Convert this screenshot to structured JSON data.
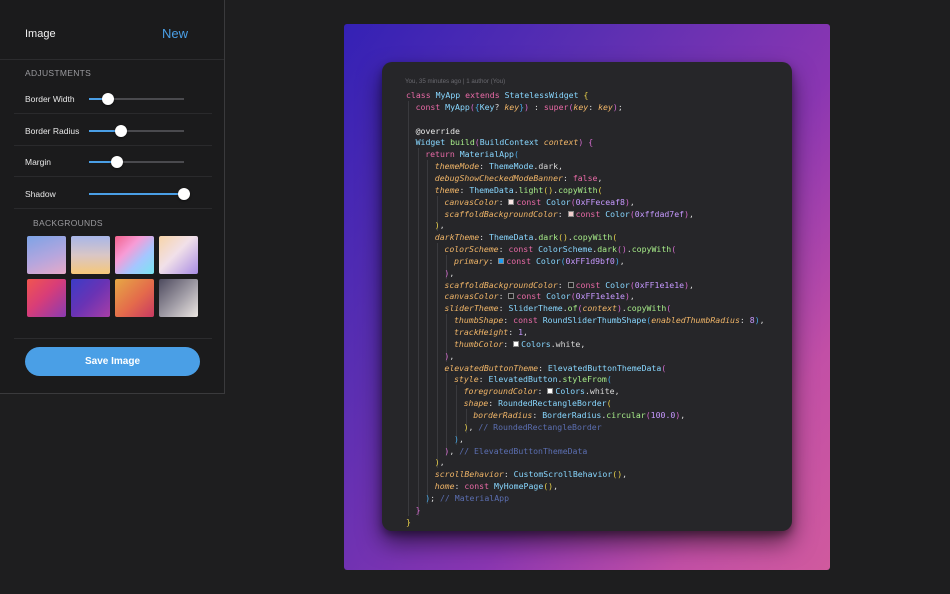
{
  "sidebar": {
    "title": "Image",
    "new_label": "New",
    "adjustments_label": "ADJUSTMENTS",
    "adjustments": [
      {
        "label": "Border Width",
        "value": 0.2
      },
      {
        "label": "Border Radius",
        "value": 0.34
      },
      {
        "label": "Margin",
        "value": 0.29
      },
      {
        "label": "Shadow",
        "value": 1.0
      }
    ],
    "backgrounds_label": "BACKGROUNDS",
    "backgrounds": [
      "linear-gradient(160deg, #7da3e6 0%, #b4a6de 55%, #e6a9c8 100%)",
      "linear-gradient(180deg, #a8b6e8 0%, #d9c6c6 50%, #f6c879 100%)",
      "linear-gradient(135deg, #f2628c 0%, #f79cd6 35%, #a5c6ff 65%, #78e6f0 100%)",
      "linear-gradient(135deg, #f7d4a8 0%, #f1e0e9 45%, #a98de4 100%)",
      "linear-gradient(135deg, #f1554f 0%, #d83d78 45%, #8a3bb2 100%)",
      "linear-gradient(135deg, #3b3cc7 0%, #6a33b4 50%, #a83ea6 100%)",
      "linear-gradient(135deg, #e6a845 0%, #e46b4b 55%, #c83962 100%)",
      "linear-gradient(135deg, #4d4a5e 0%, #a39fa8 55%, #ece6e2 100%)"
    ],
    "save_label": "Save Image",
    "accent": "#4a9fe6"
  },
  "canvas": {
    "gradient_colors": [
      "#3421b5",
      "#5b2fb2",
      "#8a36b2",
      "#c24fa6",
      "#d05a9e"
    ],
    "blame": "You, 35 minutes ago | 1 author (You)",
    "code_lines": [
      {
        "indent": 0,
        "tokens": [
          [
            "kw",
            "class "
          ],
          [
            "cls",
            "MyApp "
          ],
          [
            "kw",
            "extends "
          ],
          [
            "cls",
            "StatelessWidget "
          ],
          [
            "b1",
            "{"
          ]
        ]
      },
      {
        "indent": 1,
        "tokens": [
          [
            "kw",
            "const "
          ],
          [
            "cls",
            "MyApp"
          ],
          [
            "b2",
            "("
          ],
          [
            "b3",
            "{"
          ],
          [
            "cls",
            "Key"
          ],
          [
            "p",
            "? "
          ],
          [
            "param",
            "key"
          ],
          [
            "b3",
            "}"
          ],
          [
            "b2",
            ")"
          ],
          [
            "p",
            " : "
          ],
          [
            "kw",
            "super"
          ],
          [
            "b2",
            "("
          ],
          [
            "param",
            "key"
          ],
          [
            "p",
            ": "
          ],
          [
            "param",
            "key"
          ],
          [
            "b2",
            ")"
          ],
          [
            "p",
            ";"
          ]
        ]
      },
      {
        "indent": 0,
        "tokens": []
      },
      {
        "indent": 1,
        "tokens": [
          [
            "ann",
            "@override"
          ]
        ]
      },
      {
        "indent": 1,
        "tokens": [
          [
            "cls",
            "Widget "
          ],
          [
            "fn",
            "build"
          ],
          [
            "b2",
            "("
          ],
          [
            "cls",
            "BuildContext "
          ],
          [
            "param",
            "context"
          ],
          [
            "b2",
            ")"
          ],
          [
            "p",
            " "
          ],
          [
            "b2",
            "{"
          ]
        ]
      },
      {
        "indent": 2,
        "tokens": [
          [
            "kw",
            "return "
          ],
          [
            "cls",
            "MaterialApp"
          ],
          [
            "b3",
            "("
          ]
        ]
      },
      {
        "indent": 3,
        "tokens": [
          [
            "prop",
            "themeMode"
          ],
          [
            "p",
            ": "
          ],
          [
            "cls",
            "ThemeMode"
          ],
          [
            "p",
            "."
          ],
          [
            "p",
            "dark,"
          ]
        ]
      },
      {
        "indent": 3,
        "tokens": [
          [
            "prop",
            "debugShowCheckedModeBanner"
          ],
          [
            "p",
            ": "
          ],
          [
            "kw",
            "false"
          ],
          [
            "p",
            ","
          ]
        ]
      },
      {
        "indent": 3,
        "tokens": [
          [
            "prop",
            "theme"
          ],
          [
            "p",
            ": "
          ],
          [
            "cls",
            "ThemeData"
          ],
          [
            "p",
            "."
          ],
          [
            "fn",
            "light"
          ],
          [
            "b1",
            "()"
          ],
          [
            "p",
            "."
          ],
          [
            "fn",
            "copyWith"
          ],
          [
            "b1",
            "("
          ]
        ]
      },
      {
        "indent": 4,
        "tokens": [
          [
            "prop",
            "canvasColor"
          ],
          [
            "p",
            ": "
          ],
          [
            "sq",
            "#FFeceaf8"
          ],
          [
            "kw",
            "const "
          ],
          [
            "cls",
            "Color"
          ],
          [
            "b2",
            "("
          ],
          [
            "num",
            "0xFFeceaf8"
          ],
          [
            "b2",
            ")"
          ],
          [
            "p",
            ","
          ]
        ]
      },
      {
        "indent": 4,
        "tokens": [
          [
            "prop",
            "scaffoldBackgroundColor"
          ],
          [
            "p",
            ": "
          ],
          [
            "sq",
            "#ffdad7ef"
          ],
          [
            "kw",
            "const "
          ],
          [
            "cls",
            "Color"
          ],
          [
            "b2",
            "("
          ],
          [
            "num",
            "0xffdad7ef"
          ],
          [
            "b2",
            ")"
          ],
          [
            "p",
            ","
          ]
        ]
      },
      {
        "indent": 3,
        "tokens": [
          [
            "b1",
            ")"
          ],
          [
            "p",
            ","
          ]
        ]
      },
      {
        "indent": 3,
        "tokens": [
          [
            "prop",
            "darkTheme"
          ],
          [
            "p",
            ": "
          ],
          [
            "cls",
            "ThemeData"
          ],
          [
            "p",
            "."
          ],
          [
            "fn",
            "dark"
          ],
          [
            "b1",
            "()"
          ],
          [
            "p",
            "."
          ],
          [
            "fn",
            "copyWith"
          ],
          [
            "b1",
            "("
          ]
        ]
      },
      {
        "indent": 4,
        "tokens": [
          [
            "prop",
            "colorScheme"
          ],
          [
            "p",
            ": "
          ],
          [
            "kw",
            "const "
          ],
          [
            "cls",
            "ColorScheme"
          ],
          [
            "p",
            "."
          ],
          [
            "fn",
            "dark"
          ],
          [
            "b2",
            "()"
          ],
          [
            "p",
            "."
          ],
          [
            "fn",
            "copyWith"
          ],
          [
            "b2",
            "("
          ]
        ]
      },
      {
        "indent": 5,
        "tokens": [
          [
            "prop",
            "primary"
          ],
          [
            "p",
            ": "
          ],
          [
            "sq",
            "#1d9bf0"
          ],
          [
            "kw",
            "const "
          ],
          [
            "cls",
            "Color"
          ],
          [
            "b3",
            "("
          ],
          [
            "num",
            "0xFF1d9bf0"
          ],
          [
            "b3",
            ")"
          ],
          [
            "p",
            ","
          ]
        ]
      },
      {
        "indent": 4,
        "tokens": [
          [
            "b2",
            ")"
          ],
          [
            "p",
            ","
          ]
        ]
      },
      {
        "indent": 4,
        "tokens": [
          [
            "prop",
            "scaffoldBackgroundColor"
          ],
          [
            "p",
            ": "
          ],
          [
            "sq",
            "#1e1e1e"
          ],
          [
            "kw",
            "const "
          ],
          [
            "cls",
            "Color"
          ],
          [
            "b2",
            "("
          ],
          [
            "num",
            "0xFF1e1e1e"
          ],
          [
            "b2",
            ")"
          ],
          [
            "p",
            ","
          ]
        ]
      },
      {
        "indent": 4,
        "tokens": [
          [
            "prop",
            "canvasColor"
          ],
          [
            "p",
            ": "
          ],
          [
            "sq",
            "#1e1e1e"
          ],
          [
            "kw",
            "const "
          ],
          [
            "cls",
            "Color"
          ],
          [
            "b2",
            "("
          ],
          [
            "num",
            "0xFF1e1e1e"
          ],
          [
            "b2",
            ")"
          ],
          [
            "p",
            ","
          ]
        ]
      },
      {
        "indent": 4,
        "tokens": [
          [
            "prop",
            "sliderTheme"
          ],
          [
            "p",
            ": "
          ],
          [
            "cls",
            "SliderTheme"
          ],
          [
            "p",
            "."
          ],
          [
            "fn",
            "of"
          ],
          [
            "b2",
            "("
          ],
          [
            "param",
            "context"
          ],
          [
            "b2",
            ")"
          ],
          [
            "p",
            "."
          ],
          [
            "fn",
            "copyWith"
          ],
          [
            "b2",
            "("
          ]
        ]
      },
      {
        "indent": 5,
        "tokens": [
          [
            "prop",
            "thumbShape"
          ],
          [
            "p",
            ": "
          ],
          [
            "kw",
            "const "
          ],
          [
            "cls",
            "RoundSliderThumbShape"
          ],
          [
            "b3",
            "("
          ],
          [
            "prop",
            "enabledThumbRadius"
          ],
          [
            "p",
            ": "
          ],
          [
            "num",
            "8"
          ],
          [
            "b3",
            ")"
          ],
          [
            "p",
            ","
          ]
        ]
      },
      {
        "indent": 5,
        "tokens": [
          [
            "prop",
            "trackHeight"
          ],
          [
            "p",
            ": "
          ],
          [
            "num",
            "1"
          ],
          [
            "p",
            ","
          ]
        ]
      },
      {
        "indent": 5,
        "tokens": [
          [
            "prop",
            "thumbColor"
          ],
          [
            "p",
            ": "
          ],
          [
            "sq",
            "#ffffff"
          ],
          [
            "cls",
            "Colors"
          ],
          [
            "p",
            ".white"
          ],
          [
            "p",
            ","
          ]
        ]
      },
      {
        "indent": 4,
        "tokens": [
          [
            "b2",
            ")"
          ],
          [
            "p",
            ","
          ]
        ]
      },
      {
        "indent": 4,
        "tokens": [
          [
            "prop",
            "elevatedButtonTheme"
          ],
          [
            "p",
            ": "
          ],
          [
            "cls",
            "ElevatedButtonThemeData"
          ],
          [
            "b2",
            "("
          ]
        ]
      },
      {
        "indent": 5,
        "tokens": [
          [
            "prop",
            "style"
          ],
          [
            "p",
            ": "
          ],
          [
            "cls",
            "ElevatedButton"
          ],
          [
            "p",
            "."
          ],
          [
            "fn",
            "styleFrom"
          ],
          [
            "b3",
            "("
          ]
        ]
      },
      {
        "indent": 6,
        "tokens": [
          [
            "prop",
            "foregroundColor"
          ],
          [
            "p",
            ": "
          ],
          [
            "sq",
            "#ffffff"
          ],
          [
            "cls",
            "Colors"
          ],
          [
            "p",
            ".white"
          ],
          [
            "p",
            ","
          ]
        ]
      },
      {
        "indent": 6,
        "tokens": [
          [
            "prop",
            "shape"
          ],
          [
            "p",
            ": "
          ],
          [
            "cls",
            "RoundedRectangleBorder"
          ],
          [
            "b1",
            "("
          ]
        ]
      },
      {
        "indent": 7,
        "tokens": [
          [
            "prop",
            "borderRadius"
          ],
          [
            "p",
            ": "
          ],
          [
            "cls",
            "BorderRadius"
          ],
          [
            "p",
            "."
          ],
          [
            "fn",
            "circular"
          ],
          [
            "b2",
            "("
          ],
          [
            "num",
            "100.0"
          ],
          [
            "b2",
            ")"
          ],
          [
            "p",
            ","
          ]
        ]
      },
      {
        "indent": 6,
        "tokens": [
          [
            "b1",
            ")"
          ],
          [
            "p",
            ", "
          ],
          [
            "com",
            "// RoundedRectangleBorder"
          ]
        ]
      },
      {
        "indent": 5,
        "tokens": [
          [
            "b3",
            ")"
          ],
          [
            "p",
            ","
          ]
        ]
      },
      {
        "indent": 4,
        "tokens": [
          [
            "b2",
            ")"
          ],
          [
            "p",
            ", "
          ],
          [
            "com",
            "// ElevatedButtonThemeData"
          ]
        ]
      },
      {
        "indent": 3,
        "tokens": [
          [
            "b1",
            ")"
          ],
          [
            "p",
            ","
          ]
        ]
      },
      {
        "indent": 3,
        "tokens": [
          [
            "prop",
            "scrollBehavior"
          ],
          [
            "p",
            ": "
          ],
          [
            "cls",
            "CustomScrollBehavior"
          ],
          [
            "b1",
            "()"
          ],
          [
            "p",
            ","
          ]
        ]
      },
      {
        "indent": 3,
        "tokens": [
          [
            "prop",
            "home"
          ],
          [
            "p",
            ": "
          ],
          [
            "kw",
            "const "
          ],
          [
            "cls",
            "MyHomePage"
          ],
          [
            "b1",
            "()"
          ],
          [
            "p",
            ","
          ]
        ]
      },
      {
        "indent": 2,
        "tokens": [
          [
            "b3",
            ")"
          ],
          [
            "p",
            "; "
          ],
          [
            "com",
            "// MaterialApp"
          ]
        ]
      },
      {
        "indent": 1,
        "tokens": [
          [
            "b2",
            "}"
          ]
        ]
      },
      {
        "indent": 0,
        "tokens": [
          [
            "b1",
            "}"
          ]
        ]
      }
    ]
  }
}
